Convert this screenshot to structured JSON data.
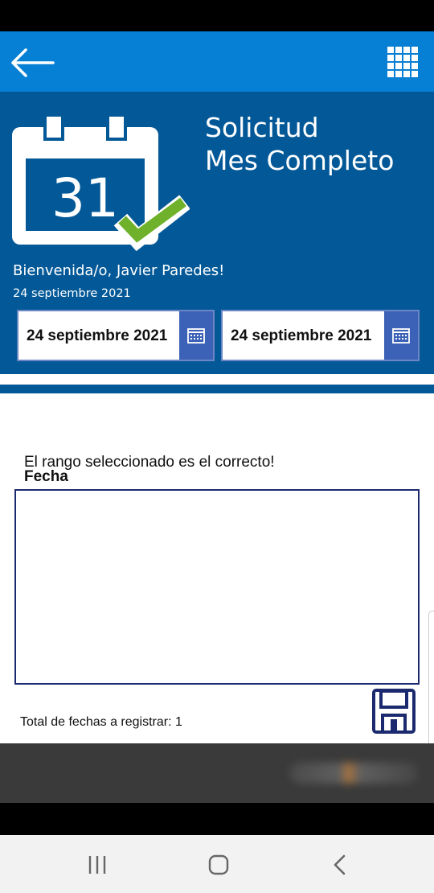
{
  "header": {
    "back_icon": "arrow-left-icon",
    "menu_icon": "grid-menu-icon",
    "header_color": "#0680d4"
  },
  "hero": {
    "title_line1": "Solicitud",
    "title_line2": "Mes Completo",
    "calendar_day": "31",
    "welcome": "Bienvenida/o, Javier Paredes!",
    "today": "24 septiembre 2021",
    "background_color": "#035998",
    "check_color": "#6fb12a"
  },
  "date_range": {
    "start": "24 septiembre 2021",
    "end": "24 septiembre 2021",
    "picker_icon": "calendar-icon"
  },
  "main": {
    "status_message": "El rango seleccionado es el correcto!",
    "fecha_label": "Fecha",
    "total_label": "Total de fechas a registrar: 1",
    "save_icon": "floppy-disk-icon"
  },
  "nav": {
    "recents_icon": "recent-apps-icon",
    "home_icon": "home-icon",
    "back_icon": "back-chevron-icon"
  }
}
